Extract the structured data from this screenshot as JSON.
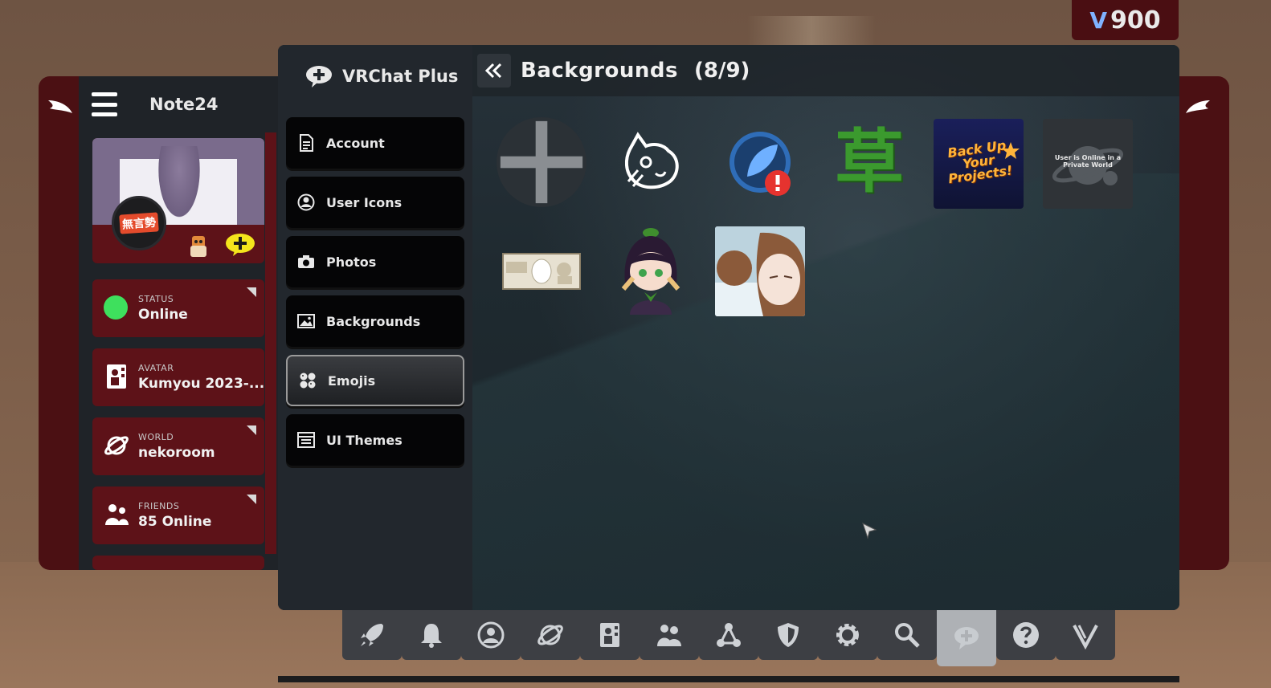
{
  "currency": {
    "symbol": "V",
    "amount": "900"
  },
  "profile": {
    "name": "Note24",
    "icon_tag": "無言勢",
    "status": {
      "label": "STATUS",
      "value": "Online"
    },
    "avatar": {
      "label": "AVATAR",
      "value": "Kumyou 2023-..."
    },
    "world": {
      "label": "WORLD",
      "value": "nekoroom"
    },
    "friends": {
      "label": "FRIENDS",
      "value": "85 Online"
    }
  },
  "side_menu": {
    "title": "VRChat Plus",
    "items": [
      {
        "label": "Account",
        "icon": "document-icon"
      },
      {
        "label": "User Icons",
        "icon": "user-circle-icon"
      },
      {
        "label": "Photos",
        "icon": "camera-icon"
      },
      {
        "label": "Backgrounds",
        "icon": "image-icon"
      },
      {
        "label": "Emojis",
        "icon": "emoji-icon"
      },
      {
        "label": "UI Themes",
        "icon": "theme-icon"
      }
    ],
    "active_item": "Emojis"
  },
  "content": {
    "title": "Backgrounds",
    "count": "(8/9)",
    "tiles": [
      {
        "name": "add",
        "icon": "plus-icon"
      },
      {
        "name": "cat-sketch-emoji"
      },
      {
        "name": "feather-error-emoji"
      },
      {
        "name": "kusa-kanji-emoji",
        "text": "草"
      },
      {
        "name": "backup-projects-emoji",
        "text": "Back Up Your Projects!"
      },
      {
        "name": "private-world-emoji",
        "text": "User is Online in a Private World"
      },
      {
        "name": "yen-note-emoji"
      },
      {
        "name": "anime-girl-emoji"
      },
      {
        "name": "photo-emoji"
      }
    ]
  },
  "dock": {
    "items": [
      "rocket-icon",
      "bell-icon",
      "user-circle-icon",
      "planet-icon",
      "avatar-icon",
      "friends-icon",
      "network-icon",
      "shield-icon",
      "gear-icon",
      "search-icon",
      "vrchat-plus-icon",
      "help-icon",
      "vrc-logo-icon"
    ],
    "active": "vrchat-plus-icon"
  },
  "colors": {
    "panel_bg": "#1f2429",
    "menu_btn": "#050506",
    "accent_red": "#5d1218",
    "status_green": "#3ee05d",
    "currency_bg": "#4a0e12"
  }
}
